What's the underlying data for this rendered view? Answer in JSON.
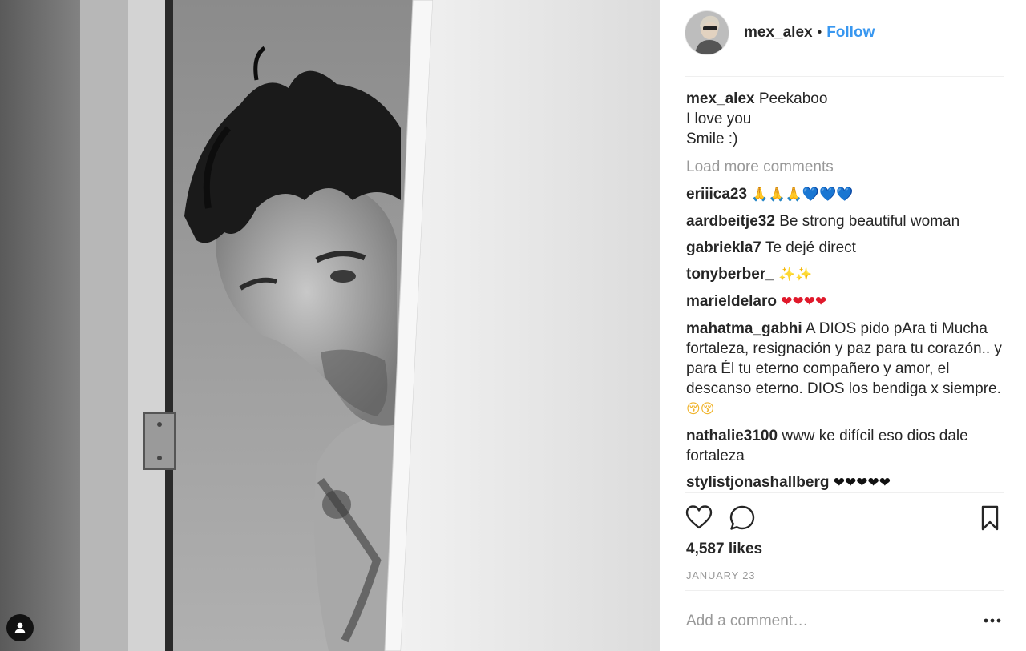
{
  "post": {
    "author": "mex_alex",
    "separator": "•",
    "follow_label": "Follow",
    "caption_lines": [
      "Peekaboo",
      "I love you",
      "Smile :)"
    ],
    "load_more_label": "Load more comments",
    "likes": "4,587 likes",
    "date": "JANUARY 23",
    "add_comment_placeholder": "Add a comment…"
  },
  "comments": [
    {
      "user": "eriiica23",
      "text": "",
      "emoji": [
        {
          "g": "🙏🙏🙏",
          "c": "pray"
        },
        {
          "g": "💙💙💙",
          "c": "blue"
        }
      ]
    },
    {
      "user": "aardbeitje32",
      "text": "Be strong beautiful woman",
      "emoji": []
    },
    {
      "user": "gabriekla7",
      "text": "Te dejé direct",
      "emoji": []
    },
    {
      "user": "tonyberber_",
      "text": "",
      "emoji": [
        {
          "g": "✨✨",
          "c": "spark"
        }
      ]
    },
    {
      "user": "marieldelaro",
      "text": "",
      "emoji": [
        {
          "g": "❤❤❤❤",
          "c": "red"
        }
      ]
    },
    {
      "user": "mahatma_gabhi",
      "text": "A DIOS pido pAra ti Mucha fortaleza, resignación y paz para tu corazón.. y para Él tu eterno compañero y amor, el descanso eterno. DIOS los bendiga x siempre.",
      "emoji": [
        {
          "g": "😚😚",
          "c": "kiss"
        }
      ]
    },
    {
      "user": "nathalie3100",
      "text": "www ke difícil eso dios dale fortaleza",
      "emoji": []
    },
    {
      "user": "stylistjonashallberg",
      "text": "",
      "emoji": [
        {
          "g": "❤❤❤❤❤",
          "c": "black"
        }
      ]
    }
  ],
  "icons": {
    "heart": "heart-icon",
    "comment": "comment-icon",
    "bookmark": "bookmark-icon",
    "more": "more-options-icon",
    "user_tag": "user-tag-icon"
  },
  "colors": {
    "accent": "#3897f0",
    "text": "#262626",
    "muted": "#999999",
    "divider": "#efefef"
  }
}
